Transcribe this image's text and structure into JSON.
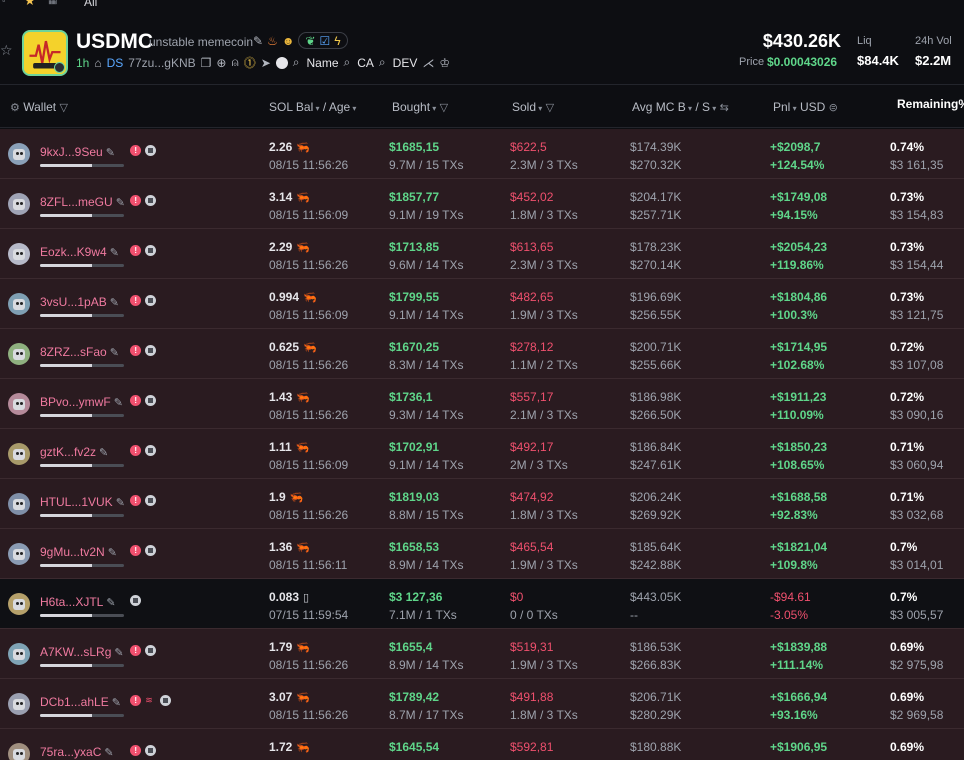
{
  "topbar": {
    "filter_label": "All"
  },
  "token": {
    "symbol": "USDMC",
    "name": "unstable memecoin",
    "age": "1h",
    "ds_label": "DS",
    "ca_short": "77zu...gKNB",
    "search_name": "Name",
    "search_ca": "CA",
    "search_dev": "DEV",
    "market_cap": "$430.26K",
    "price_label": "Price",
    "price": "$0.00043026",
    "liq_label": "Liq",
    "liq": "$84.4K",
    "vol_label": "24h Vol",
    "vol": "$2.2M"
  },
  "columns": {
    "wallet": "Wallet",
    "sol_bal": "SOL Bal",
    "age": "/ Age",
    "bought": "Bought",
    "sold": "Sold",
    "avg_mc": "Avg MC B",
    "avg_mc_s": "/ S",
    "pnl": "Pnl",
    "usd": "USD",
    "remaining": "Remaining%"
  },
  "rows": [
    {
      "wallet": "9kxJ...9Seu",
      "bar": 0.62,
      "tags": [
        "red",
        "gray"
      ],
      "sol": "2.26",
      "icon": "fish",
      "date": "08/15 11:56:26",
      "bought": "$1685,15",
      "btx": "9.7M / 15 TXs",
      "sold": "$622,5",
      "stx": "2.3M / 3 TXs",
      "mcb": "$174.39K",
      "mcs": "$270.32K",
      "pnl": "+$2098,7",
      "pnlp": "+124.54%",
      "rem": "0.74%",
      "remv": "$3 161,35",
      "neg": false
    },
    {
      "wallet": "8ZFL...meGU",
      "bar": 0.62,
      "tags": [
        "red",
        "gray"
      ],
      "sol": "3.14",
      "icon": "fish",
      "date": "08/15 11:56:09",
      "bought": "$1857,77",
      "btx": "9.1M / 19 TXs",
      "sold": "$452,02",
      "stx": "1.8M / 3 TXs",
      "mcb": "$204.17K",
      "mcs": "$257.71K",
      "pnl": "+$1749,08",
      "pnlp": "+94.15%",
      "rem": "0.73%",
      "remv": "$3 154,83",
      "neg": false
    },
    {
      "wallet": "Eozk...K9w4",
      "bar": 0.62,
      "tags": [
        "red",
        "gray"
      ],
      "sol": "2.29",
      "icon": "fish",
      "date": "08/15 11:56:26",
      "bought": "$1713,85",
      "btx": "9.6M / 14 TXs",
      "sold": "$613,65",
      "stx": "2.3M / 3 TXs",
      "mcb": "$178.23K",
      "mcs": "$270.14K",
      "pnl": "+$2054,23",
      "pnlp": "+119.86%",
      "rem": "0.73%",
      "remv": "$3 154,44",
      "neg": false
    },
    {
      "wallet": "3vsU...1pAB",
      "bar": 0.62,
      "tags": [
        "red",
        "gray"
      ],
      "sol": "0.994",
      "icon": "fish",
      "date": "08/15 11:56:09",
      "bought": "$1799,55",
      "btx": "9.1M / 14 TXs",
      "sold": "$482,65",
      "stx": "1.9M / 3 TXs",
      "mcb": "$196.69K",
      "mcs": "$256.55K",
      "pnl": "+$1804,86",
      "pnlp": "+100.3%",
      "rem": "0.73%",
      "remv": "$3 121,75",
      "neg": false
    },
    {
      "wallet": "8ZRZ...sFao",
      "bar": 0.62,
      "tags": [
        "red",
        "gray"
      ],
      "sol": "0.625",
      "icon": "fish",
      "date": "08/15 11:56:26",
      "bought": "$1670,25",
      "btx": "8.3M / 14 TXs",
      "sold": "$278,12",
      "stx": "1.1M / 2 TXs",
      "mcb": "$200.71K",
      "mcs": "$255.66K",
      "pnl": "+$1714,95",
      "pnlp": "+102.68%",
      "rem": "0.72%",
      "remv": "$3 107,08",
      "neg": false
    },
    {
      "wallet": "BPvo...ymwF",
      "bar": 0.62,
      "tags": [
        "red",
        "gray"
      ],
      "sol": "1.43",
      "icon": "fish",
      "date": "08/15 11:56:26",
      "bought": "$1736,1",
      "btx": "9.3M / 14 TXs",
      "sold": "$557,17",
      "stx": "2.1M / 3 TXs",
      "mcb": "$186.98K",
      "mcs": "$266.50K",
      "pnl": "+$1911,23",
      "pnlp": "+110.09%",
      "rem": "0.72%",
      "remv": "$3 090,16",
      "neg": false
    },
    {
      "wallet": "gztK...fv2z",
      "bar": 0.62,
      "tags": [
        "red",
        "gray"
      ],
      "sol": "1.11",
      "icon": "fish",
      "date": "08/15 11:56:09",
      "bought": "$1702,91",
      "btx": "9.1M / 14 TXs",
      "sold": "$492,17",
      "stx": "2M / 3 TXs",
      "mcb": "$186.84K",
      "mcs": "$247.61K",
      "pnl": "+$1850,23",
      "pnlp": "+108.65%",
      "rem": "0.71%",
      "remv": "$3 060,94",
      "neg": false
    },
    {
      "wallet": "HTUL...1VUK",
      "bar": 0.62,
      "tags": [
        "red",
        "gray"
      ],
      "sol": "1.9",
      "icon": "fish",
      "date": "08/15 11:56:26",
      "bought": "$1819,03",
      "btx": "8.8M / 15 TXs",
      "sold": "$474,92",
      "stx": "1.8M / 3 TXs",
      "mcb": "$206.24K",
      "mcs": "$269.92K",
      "pnl": "+$1688,58",
      "pnlp": "+92.83%",
      "rem": "0.71%",
      "remv": "$3 032,68",
      "neg": false
    },
    {
      "wallet": "9gMu...tv2N",
      "bar": 0.62,
      "tags": [
        "red",
        "gray"
      ],
      "sol": "1.36",
      "icon": "fish",
      "date": "08/15 11:56:11",
      "bought": "$1658,53",
      "btx": "8.9M / 14 TXs",
      "sold": "$465,54",
      "stx": "1.9M / 3 TXs",
      "mcb": "$185.64K",
      "mcs": "$242.88K",
      "pnl": "+$1821,04",
      "pnlp": "+109.8%",
      "rem": "0.7%",
      "remv": "$3 014,01",
      "neg": false
    },
    {
      "wallet": "H6ta...XJTL",
      "bar": 0.62,
      "tags": [
        "gray"
      ],
      "sol": "0.083",
      "icon": "square",
      "date": "07/15 11:59:54",
      "bought": "$3 127,36",
      "btx": "7.1M / 1 TXs",
      "sold": "$0",
      "stx": "0 / 0 TXs",
      "mcb": "$443.05K",
      "mcs": "--",
      "pnl": "-$94.61",
      "pnlp": "-3.05%",
      "rem": "0.7%",
      "remv": "$3 005,57",
      "neg": true
    },
    {
      "wallet": "A7KW...sLRg",
      "bar": 0.62,
      "tags": [
        "red",
        "gray"
      ],
      "sol": "1.79",
      "icon": "fish",
      "date": "08/15 11:56:26",
      "bought": "$1655,4",
      "btx": "8.9M / 14 TXs",
      "sold": "$519,31",
      "stx": "1.9M / 3 TXs",
      "mcb": "$186.53K",
      "mcs": "$266.83K",
      "pnl": "+$1839,88",
      "pnlp": "+111.14%",
      "rem": "0.69%",
      "remv": "$2 975,98",
      "neg": false
    },
    {
      "wallet": "DCb1...ahLE",
      "bar": 0.62,
      "tags": [
        "red",
        "stack",
        "gray"
      ],
      "sol": "3.07",
      "icon": "fish",
      "date": "08/15 11:56:26",
      "bought": "$1789,42",
      "btx": "8.7M / 17 TXs",
      "sold": "$491,88",
      "stx": "1.8M / 3 TXs",
      "mcb": "$206.71K",
      "mcs": "$280.29K",
      "pnl": "+$1666,94",
      "pnlp": "+93.16%",
      "rem": "0.69%",
      "remv": "$2 969,58",
      "neg": false
    },
    {
      "wallet": "75ra...yxaC",
      "bar": 0.62,
      "tags": [
        "red",
        "gray"
      ],
      "sol": "1.72",
      "icon": "fish",
      "date": "",
      "bought": "$1645,54",
      "btx": "",
      "sold": "$592,81",
      "stx": "",
      "mcb": "$180.88K",
      "mcs": "",
      "pnl": "+$1906,95",
      "pnlp": "",
      "rem": "0.69%",
      "remv": "",
      "neg": false
    }
  ]
}
